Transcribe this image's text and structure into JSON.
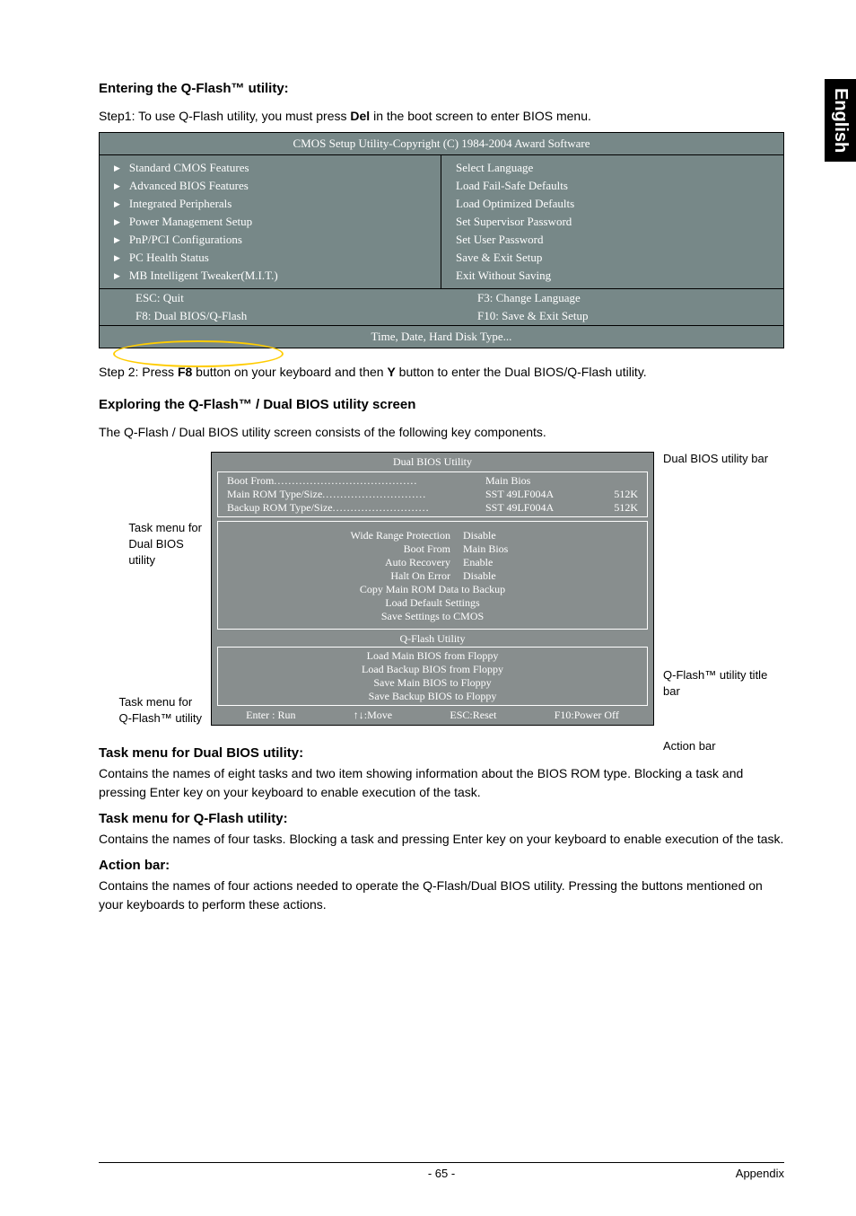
{
  "sideTab": "English",
  "headings": {
    "entering": "Entering the Q-Flash™ utility:",
    "exploring": "Exploring the Q-Flash™ / Dual BIOS utility screen"
  },
  "step1": {
    "prefix": "Step1: To use Q-Flash utility, you must press ",
    "key": "Del",
    "suffix": " in the boot screen to enter BIOS menu."
  },
  "biosTable": {
    "header": "CMOS Setup Utility-Copyright (C) 1984-2004 Award Software",
    "leftItems": [
      "Standard CMOS Features",
      "Advanced BIOS Features",
      "Integrated Peripherals",
      "Power Management Setup",
      "PnP/PCI Configurations",
      "PC Health Status",
      "MB Intelligent Tweaker(M.I.T.)"
    ],
    "rightItems": [
      "Select Language",
      "Load Fail-Safe Defaults",
      "Load Optimized Defaults",
      "Set Supervisor Password",
      "Set User Password",
      "Save & Exit Setup",
      "Exit Without Saving"
    ],
    "footerLeft1": "ESC: Quit",
    "footerRight1": "F3: Change Language",
    "footerLeft2": "F8: Dual BIOS/Q-Flash",
    "footerRight2": "F10: Save & Exit Setup",
    "helpBar": "Time, Date, Hard Disk Type..."
  },
  "step2": {
    "prefix": "Step 2: Press ",
    "key1": "F8",
    "mid": " button on your keyboard and then ",
    "key2": "Y",
    "suffix": " button to enter the Dual BIOS/Q-Flash utility."
  },
  "exploringSub": "The Q-Flash / Dual BIOS utility screen consists of the following key components.",
  "diagram": {
    "dualTitle": "Dual BIOS Utility",
    "bootFromLabel": "Boot From",
    "bootFromValue": "Main Bios",
    "mainRom": "Main ROM Type/Size",
    "mainRomChip": "SST 49LF004A",
    "mainRomSize": "512K",
    "backupRom": "Backup ROM Type/Size",
    "backupRomChip": "SST 49LF004A",
    "backupRomSize": "512K",
    "opts": [
      {
        "k": "Wide Range Protection",
        "v": "Disable"
      },
      {
        "k": "Boot From",
        "v": "Main Bios"
      },
      {
        "k": "Auto Recovery",
        "v": "Enable"
      },
      {
        "k": "Halt On Error",
        "v": "Disable"
      }
    ],
    "centerLines": [
      "Copy Main ROM Data to Backup",
      "Load Default Settings",
      "Save Settings to CMOS"
    ],
    "qfTitle": "Q-Flash Utility",
    "qfItems": [
      "Load Main BIOS from Floppy",
      "Load Backup BIOS from Floppy",
      "Save Main BIOS to Floppy",
      "Save Backup BIOS to Floppy"
    ],
    "actions": {
      "enter": "Enter : Run",
      "move": "↑↓:Move",
      "esc": "ESC:Reset",
      "f10": "F10:Power Off"
    },
    "labels": {
      "leftTop1": "Task menu for",
      "leftTop2": "Dual BIOS",
      "leftTop3": "utility",
      "leftBot1": "Task menu for",
      "leftBot2": "Q-Flash™ utility",
      "right1": "Dual BIOS utility bar",
      "right2a": "Q-Flash™ utility title",
      "right2b": "bar",
      "right3": "Action bar"
    }
  },
  "sections": [
    {
      "h": "Task menu for Dual BIOS utility:",
      "p": "Contains the names of eight tasks and two item showing information about the BIOS ROM type. Blocking a task and pressing Enter key on your keyboard to enable execution of the task."
    },
    {
      "h": "Task menu for Q-Flash utility:",
      "p": "Contains the names of four tasks. Blocking a task and pressing Enter key on your keyboard to enable execution of the task."
    },
    {
      "h": "Action bar:",
      "p": "Contains the names of four actions needed to operate the Q-Flash/Dual BIOS utility. Pressing the buttons mentioned on your keyboards to perform these actions."
    }
  ],
  "footer": {
    "page": "- 65 -",
    "section": "Appendix"
  }
}
